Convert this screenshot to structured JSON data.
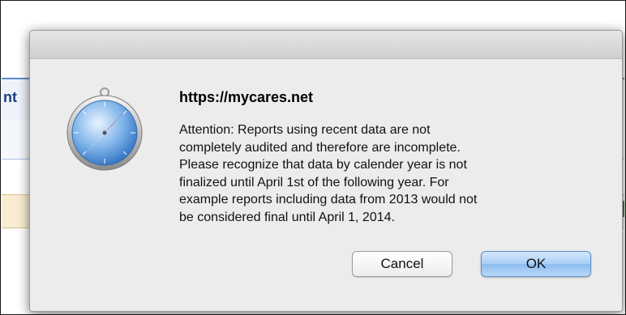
{
  "background_page": {
    "column_header_fragment": "nt"
  },
  "dialog": {
    "title": "https://mycares.net",
    "message": "Attention: Reports using recent data are not\ncompletely audited and therefore are incomplete.\nPlease recognize that data by calender year is not\nfinalized until April 1st of the following year. For\nexample reports including data from 2013 would not\nbe considered final until April 1, 2014.",
    "buttons": {
      "cancel_label": "Cancel",
      "ok_label": "OK"
    },
    "icon": "safari-compass-icon"
  },
  "colors": {
    "ok_button_accent": "#8dbcef",
    "sheet_background": "#ececec",
    "page_header_border": "#5e8ac6",
    "page_highlight_row": "#f8edd2"
  }
}
